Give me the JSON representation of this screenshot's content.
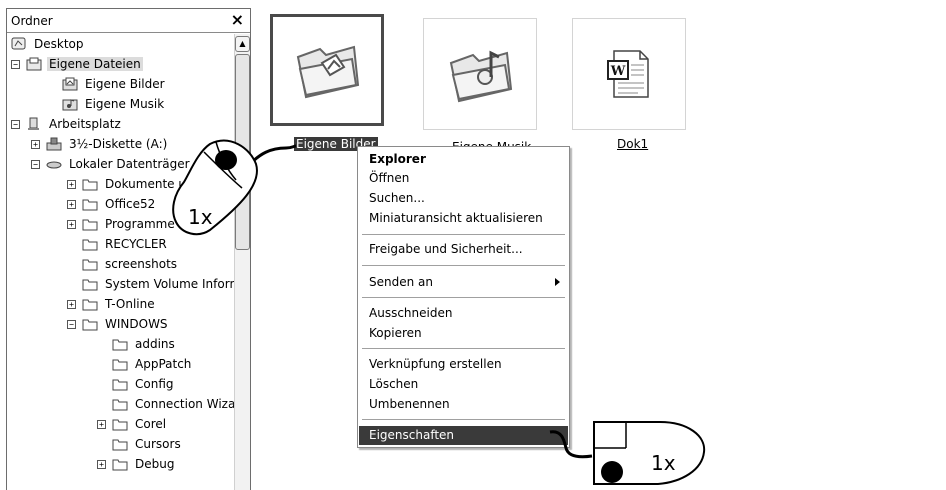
{
  "folder_pane": {
    "title": "Ordner",
    "close_glyph": "×",
    "scroll_up_glyph": "▲",
    "tree": [
      {
        "label": "Desktop",
        "icon": "desktop-icon",
        "expander": "",
        "selected": false
      },
      {
        "label": "Eigene Dateien",
        "icon": "my-documents-icon",
        "expander": "−",
        "selected": true
      },
      {
        "label": "Eigene Bilder",
        "icon": "my-pictures-icon",
        "expander": "",
        "selected": false
      },
      {
        "label": "Eigene Musik",
        "icon": "my-music-icon",
        "expander": "",
        "selected": false
      },
      {
        "label": "Arbeitsplatz",
        "icon": "computer-icon",
        "expander": "−",
        "selected": false
      },
      {
        "label": "3½-Diskette (A:)",
        "icon": "floppy-drive-icon",
        "expander": "+",
        "selected": false
      },
      {
        "label": "Lokaler Datenträger (C:)",
        "icon": "hard-drive-icon",
        "expander": "−",
        "selected": false
      },
      {
        "label": "Dokumente und Einstellungen",
        "icon": "folder-icon",
        "expander": "+",
        "selected": false
      },
      {
        "label": "Office52",
        "icon": "folder-icon",
        "expander": "+",
        "selected": false
      },
      {
        "label": "Programme",
        "icon": "folder-icon",
        "expander": "+",
        "selected": false
      },
      {
        "label": "RECYCLER",
        "icon": "folder-icon",
        "expander": "",
        "selected": false
      },
      {
        "label": "screenshots",
        "icon": "folder-icon",
        "expander": "",
        "selected": false
      },
      {
        "label": "System Volume Information",
        "icon": "folder-icon",
        "expander": "",
        "selected": false
      },
      {
        "label": "T-Online",
        "icon": "folder-icon",
        "expander": "+",
        "selected": false
      },
      {
        "label": "WINDOWS",
        "icon": "folder-icon",
        "expander": "−",
        "selected": false
      },
      {
        "label": "addins",
        "icon": "folder-icon",
        "expander": "",
        "selected": false
      },
      {
        "label": "AppPatch",
        "icon": "folder-icon",
        "expander": "",
        "selected": false
      },
      {
        "label": "Config",
        "icon": "folder-icon",
        "expander": "",
        "selected": false
      },
      {
        "label": "Connection Wizard",
        "icon": "folder-icon",
        "expander": "",
        "selected": false
      },
      {
        "label": "Corel",
        "icon": "folder-icon",
        "expander": "+",
        "selected": false
      },
      {
        "label": "Cursors",
        "icon": "folder-icon",
        "expander": "",
        "selected": false
      },
      {
        "label": "Debug",
        "icon": "folder-icon",
        "expander": "+",
        "selected": false
      }
    ]
  },
  "content": {
    "items": [
      {
        "label": "Eigene Bilder",
        "icon": "pictures-folder-icon",
        "selected": true
      },
      {
        "label": "Eigene Musik",
        "icon": "music-folder-icon",
        "selected": false
      },
      {
        "label": "Dok1",
        "icon": "word-document-icon",
        "selected": false
      }
    ]
  },
  "context_menu": {
    "items": [
      {
        "label": "Explorer",
        "bold": true
      },
      {
        "label": "Öffnen"
      },
      {
        "label": "Suchen..."
      },
      {
        "label": "Miniaturansicht aktualisieren"
      },
      {
        "label": "Freigabe und Sicherheit..."
      },
      {
        "label": "Senden an",
        "submenu": true
      },
      {
        "label": "Ausschneiden"
      },
      {
        "label": "Kopieren"
      },
      {
        "label": "Verknüpfung erstellen"
      },
      {
        "label": "Löschen"
      },
      {
        "label": "Umbenennen"
      },
      {
        "label": "Eigenschaften",
        "highlighted": true
      }
    ]
  },
  "annotations": {
    "left_mouse_click": "1x",
    "right_mouse_click": "1x"
  }
}
